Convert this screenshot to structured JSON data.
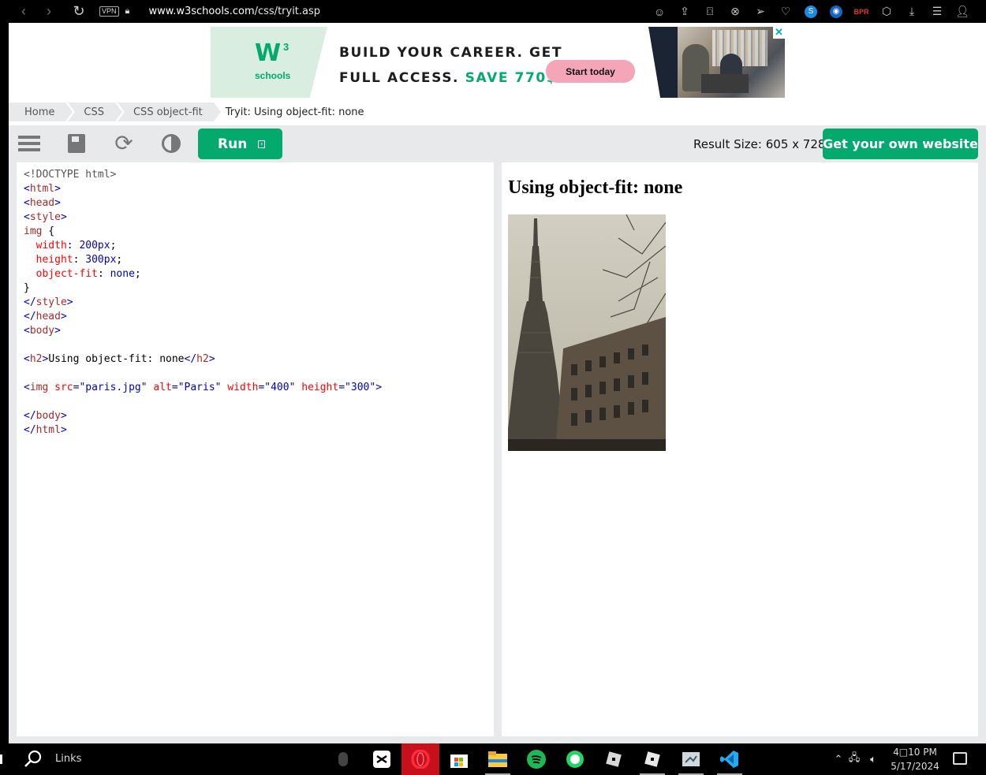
{
  "browser": {
    "vpn_label": "VPN",
    "url_host": "www.w3schools.com",
    "url_path": "/css/tryit.asp",
    "bpr_label": "BPR"
  },
  "ad": {
    "logo_sup": "3",
    "logo_text": "schools",
    "headline_line1": "BUILD YOUR CAREER. GET",
    "headline_line2_prefix": "FULL ACCESS. ",
    "headline_line2_save": "SAVE 770$",
    "cta": "Start today",
    "close": "✕"
  },
  "breadcrumbs": {
    "items": [
      "Home",
      "CSS",
      "CSS object-fit"
    ],
    "current": "Tryit: Using object-fit: none"
  },
  "toolbar": {
    "run_label": "Run",
    "result_size_label": "Result Size: 605 x 728",
    "get_site_label": "Get your own website"
  },
  "editor": {
    "lines": [
      "<!DOCTYPE html>",
      "<html>",
      "<head>",
      "<style>",
      "img {",
      "  width: 200px;",
      "  height: 300px;",
      "  object-fit: none;",
      "}",
      "</style>",
      "</head>",
      "<body>",
      "",
      "<h2>Using object-fit: none</h2>",
      "",
      "<img src=\"paris.jpg\" alt=\"Paris\" width=\"400\" height=\"300\">",
      "",
      "</body>",
      "</html>"
    ]
  },
  "result": {
    "heading": "Using object-fit: none"
  },
  "taskbar": {
    "search_label": "Links",
    "time": "4□10 PM",
    "date": "5/17/2024"
  },
  "colors": {
    "brand_green": "#04aa6d",
    "toolbar_bg": "#e7e9eb",
    "ad_cta_pink": "#f4a5b8"
  }
}
